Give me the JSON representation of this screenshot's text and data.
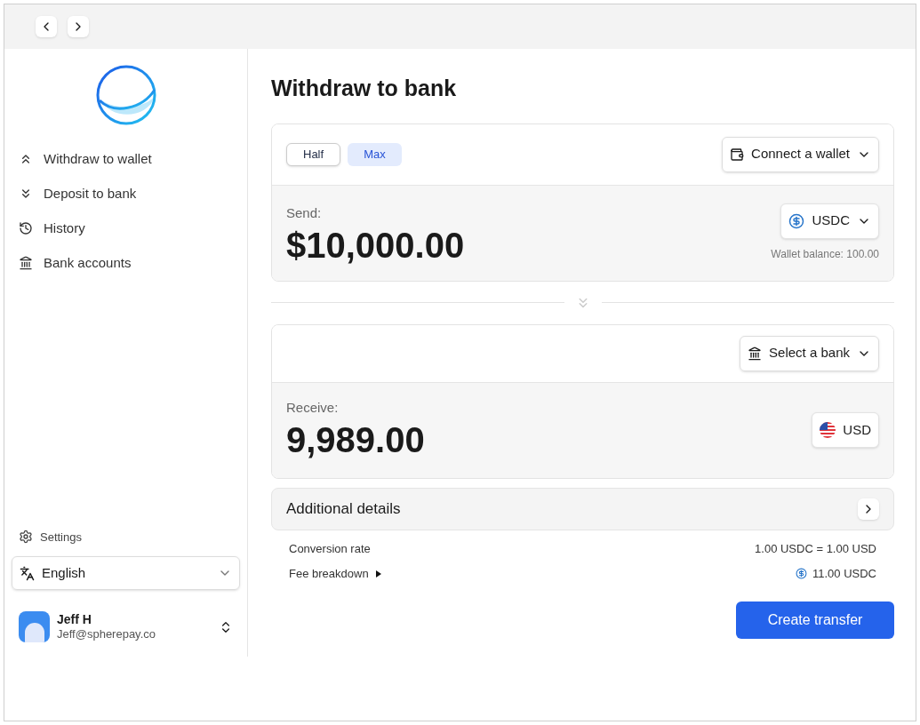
{
  "sidebar": {
    "items": [
      {
        "kind": "withdraw",
        "label": "Withdraw to wallet"
      },
      {
        "kind": "deposit",
        "label": "Deposit to bank"
      },
      {
        "kind": "history",
        "label": "History"
      },
      {
        "kind": "bank",
        "label": "Bank accounts"
      }
    ],
    "settings": "Settings",
    "language": "English",
    "user": {
      "name": "Jeff H",
      "email": "Jeff@spherepay.co"
    }
  },
  "title": "Withdraw to bank",
  "send": {
    "amount_buttons": [
      {
        "label": "Half",
        "selected": false
      },
      {
        "label": "Max",
        "selected": true
      }
    ],
    "wallet_select": "Connect a wallet",
    "label": "Send:",
    "amount": "$10,000.00",
    "currency": "USDC",
    "balance": "Wallet balance: 100.00"
  },
  "receive": {
    "bank_select": "Select a bank",
    "label": "Receive:",
    "amount": "9,989.00",
    "currency": "USD"
  },
  "details": {
    "title": "Additional details",
    "rows": [
      {
        "label": "Conversion rate",
        "value": "1.00 USDC = 1.00 USD",
        "expandable": false,
        "coin": false
      },
      {
        "label": "Fee breakdown",
        "value": "11.00 USDC",
        "expandable": true,
        "coin": true
      }
    ]
  },
  "submit": "Create transfer"
}
